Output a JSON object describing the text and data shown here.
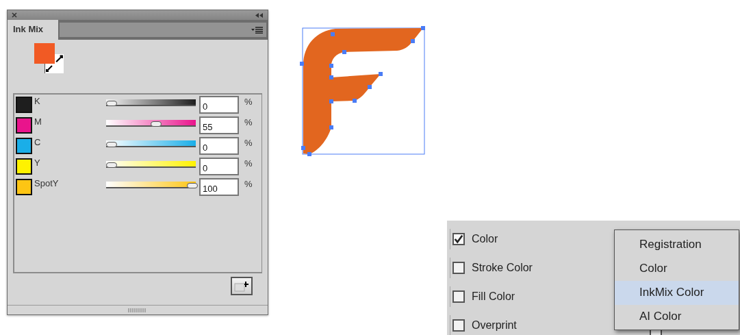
{
  "panel": {
    "tab": "Ink Mix",
    "channels": [
      {
        "name": "K",
        "color": "#1e1e1e",
        "level": 0,
        "value": "0",
        "unit": "%"
      },
      {
        "name": "M",
        "color": "#e9148c",
        "level": 0.55,
        "value": "55",
        "unit": "%"
      },
      {
        "name": "C",
        "color": "#1aaee8",
        "level": 0,
        "value": "0",
        "unit": "%"
      },
      {
        "name": "Y",
        "color": "#fff200",
        "level": 0,
        "value": "0",
        "unit": "%"
      },
      {
        "name": "SpotY",
        "color": "#fdc514",
        "level": 1,
        "value": "100",
        "unit": "%"
      }
    ]
  },
  "options": [
    {
      "label": "Color",
      "checked": true
    },
    {
      "label": "Stroke Color",
      "checked": false
    },
    {
      "label": "Fill Color",
      "checked": false
    },
    {
      "label": "Overprint",
      "checked": false
    }
  ],
  "checkbox_under_menu": {
    "checked": false
  },
  "menu": [
    {
      "label": "Registration",
      "selected": false
    },
    {
      "label": "Color",
      "selected": false
    },
    {
      "label": "InkMix Color",
      "selected": true
    },
    {
      "label": "AI Color",
      "selected": false
    }
  ]
}
